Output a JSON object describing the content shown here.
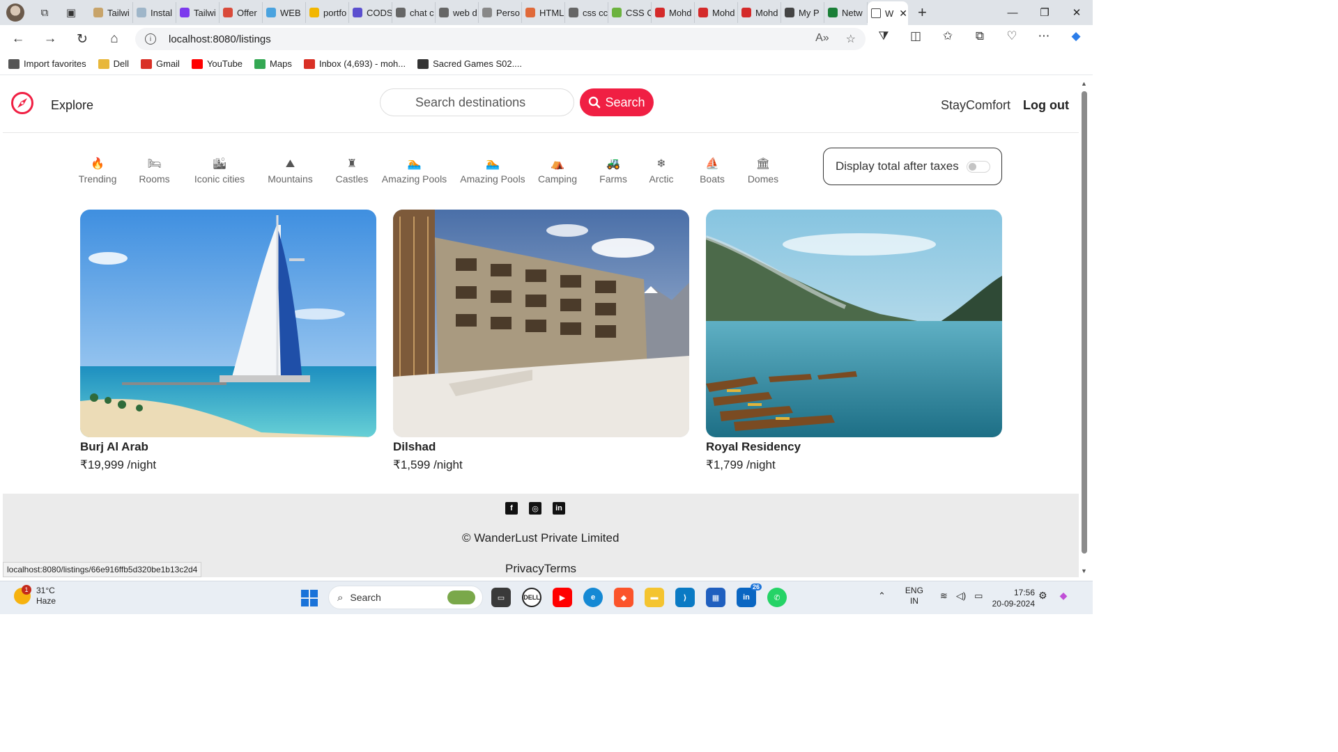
{
  "browser": {
    "tabs": [
      {
        "label": "Tailwi",
        "color": "#c8a46a"
      },
      {
        "label": "Instal",
        "color": "#9fb6c9"
      },
      {
        "label": "Tailwi",
        "color": "#7c3aed"
      },
      {
        "label": "Offer",
        "color": "#d94a3a"
      },
      {
        "label": "WEB",
        "color": "#4aa3df"
      },
      {
        "label": "portfo",
        "color": "#f2b600"
      },
      {
        "label": "CODS",
        "color": "#5b4fcf"
      },
      {
        "label": "chat c",
        "color": "#666666"
      },
      {
        "label": "web d",
        "color": "#666666"
      },
      {
        "label": "Perso",
        "color": "#888888"
      },
      {
        "label": "HTML",
        "color": "#e06a3a"
      },
      {
        "label": "css cc",
        "color": "#666666"
      },
      {
        "label": "CSS C",
        "color": "#6cb33f"
      },
      {
        "label": "Mohd",
        "color": "#d42a2a"
      },
      {
        "label": "Mohd",
        "color": "#d42a2a"
      },
      {
        "label": "Mohd",
        "color": "#d42a2a"
      },
      {
        "label": "My P",
        "color": "#444444"
      },
      {
        "label": "Netw",
        "color": "#1a7f37"
      }
    ],
    "active_tab": {
      "label": "W"
    },
    "url": "localhost:8080/listings",
    "favorites": [
      {
        "label": "Import favorites",
        "color": "#555555"
      },
      {
        "label": "Dell",
        "color": "#e8b73a"
      },
      {
        "label": "Gmail",
        "color": "#d93025"
      },
      {
        "label": "YouTube",
        "color": "#ff0000"
      },
      {
        "label": "Maps",
        "color": "#34a853"
      },
      {
        "label": "Inbox (4,693) - moh...",
        "color": "#d93025"
      },
      {
        "label": "Sacred Games S02....",
        "color": "#333333"
      }
    ],
    "status_url": "localhost:8080/listings/66e916ffb5d320be1b13c2d4"
  },
  "site": {
    "nav": {
      "explore": "Explore",
      "search_placeholder": "Search destinations",
      "search_button": "Search",
      "host_link": "StayComfort",
      "logout": "Log out"
    },
    "filters": [
      {
        "label": "Trending",
        "icon": "fire-icon",
        "glyph": "🔥"
      },
      {
        "label": "Rooms",
        "icon": "bed-icon",
        "glyph": "🛏"
      },
      {
        "label": "Iconic cities",
        "icon": "city-icon",
        "glyph": "🏙"
      },
      {
        "label": "Mountains",
        "icon": "mountain-icon",
        "glyph": "⛰"
      },
      {
        "label": "Castles",
        "icon": "castle-icon",
        "glyph": "♜"
      },
      {
        "label": "Amazing Pools",
        "icon": "pool-icon",
        "glyph": "🏊"
      },
      {
        "label": "Amazing Pools",
        "icon": "pool-icon",
        "glyph": "🏊"
      },
      {
        "label": "Camping",
        "icon": "tent-icon",
        "glyph": "⛺"
      },
      {
        "label": "Farms",
        "icon": "tractor-icon",
        "glyph": "🚜"
      },
      {
        "label": "Arctic",
        "icon": "snowflake-icon",
        "glyph": "❄"
      },
      {
        "label": "Boats",
        "icon": "sailboat-icon",
        "glyph": "⛵"
      },
      {
        "label": "Domes",
        "icon": "dome-icon",
        "glyph": "🏛"
      }
    ],
    "tax_toggle_label": "Display total after taxes",
    "tax_toggle_on": false,
    "listings": [
      {
        "title": "Burj Al Arab",
        "price": "₹19,999 /night"
      },
      {
        "title": "Dilshad",
        "price": "₹1,599 /night"
      },
      {
        "title": "Royal Residency",
        "price": "₹1,799 /night"
      }
    ],
    "footer": {
      "socials": [
        "facebook-icon",
        "instagram-icon",
        "linkedin-icon"
      ],
      "copyright": "© WanderLust Private Limited",
      "links": "PrivacyTerms"
    }
  },
  "taskbar": {
    "weather_temp": "31°C",
    "weather_desc": "Haze",
    "weather_badge": "1",
    "search_label": "Search",
    "linkedin_badge": "26",
    "lang_top": "ENG",
    "lang_bottom": "IN",
    "time": "17:56",
    "date": "20-09-2024"
  }
}
